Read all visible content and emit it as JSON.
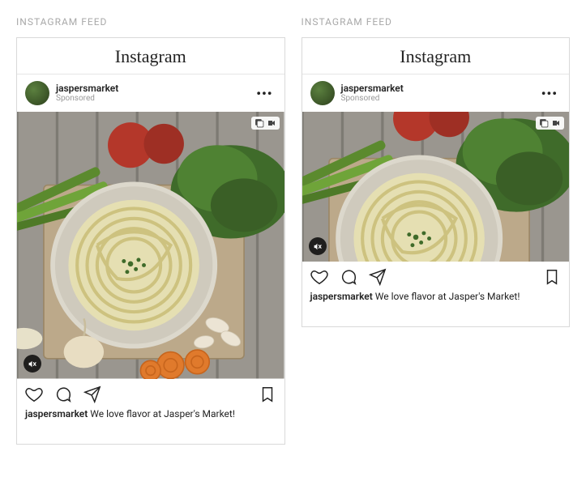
{
  "sectionTitle": "INSTAGRAM FEED",
  "brand": "Instagram",
  "posts": [
    {
      "username": "jaspersmarket",
      "sponsored": "Sponsored",
      "captionUser": "jaspersmarket",
      "captionText": " We love flavor at Jasper's Market!",
      "aspect": "square"
    },
    {
      "username": "jaspersmarket",
      "sponsored": "Sponsored",
      "captionUser": "jaspersmarket",
      "captionText": " We love flavor at Jasper's Market!",
      "aspect": "wide"
    }
  ],
  "icons": {
    "more": "•••"
  }
}
